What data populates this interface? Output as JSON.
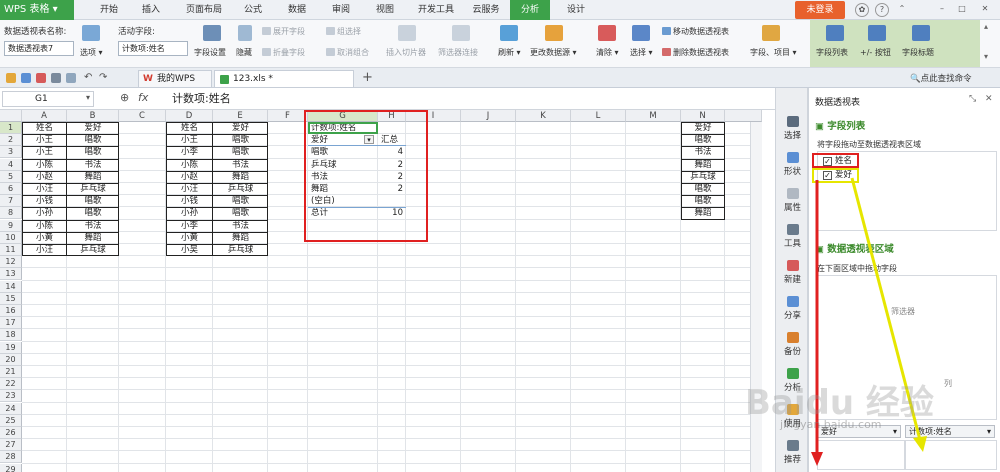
{
  "app": {
    "logo": "WPS 表格",
    "login_label": "未登录"
  },
  "menu": {
    "tabs": [
      "开始",
      "插入",
      "页面布局",
      "公式",
      "数据",
      "审阅",
      "视图",
      "开发工具",
      "云服务",
      "分析",
      "设计"
    ],
    "active": "分析"
  },
  "ribbon": {
    "pivot_name_label": "数据透视表名称:",
    "pivot_name_value": "数据透视表7",
    "options_label": "选项",
    "active_field_label": "活动字段:",
    "active_field_value": "计数项:姓名",
    "field_settings_label": "字段设置",
    "hide_label": "隐藏",
    "expand_label": "展开字段",
    "collapse_label": "折叠字段",
    "group_label": "组选择",
    "ungroup_label": "取消组合",
    "insert_slicer_label": "插入切片器",
    "filter_conn_label": "筛选器连接",
    "refresh_label": "刷新",
    "change_source_label": "更改数据源",
    "clear_label": "清除",
    "select_label": "选择",
    "move_pivot_label": "移动数据透视表",
    "delete_pivot_label": "删除数据透视表",
    "fields_items_label": "字段、项目",
    "field_list_label": "字段列表",
    "plusminus_label": "+/- 按钮",
    "field_headers_label": "字段标题"
  },
  "tabbar": {
    "wps_tab": "我的WPS",
    "file_tab": "123.xls *",
    "search_label": "点此查找命令"
  },
  "formula_bar": {
    "cell_ref": "G1",
    "fx": "fx",
    "content": "计数项:姓名"
  },
  "sheet": {
    "columns": [
      "A",
      "B",
      "C",
      "D",
      "E",
      "F",
      "G",
      "H",
      "I",
      "J",
      "K",
      "L",
      "M",
      "N"
    ],
    "rows": [
      "1",
      "2",
      "3",
      "4",
      "5",
      "6",
      "7",
      "8",
      "9",
      "10",
      "11",
      "12",
      "13",
      "14",
      "15",
      "16",
      "17",
      "18",
      "19",
      "20",
      "21",
      "22",
      "23",
      "24",
      "25",
      "26",
      "27",
      "28",
      "29"
    ],
    "table1": [
      [
        "姓名",
        "爱好"
      ],
      [
        "小王",
        "唱歌"
      ],
      [
        "小王",
        "唱歌"
      ],
      [
        "小陈",
        "书法"
      ],
      [
        "小赵",
        "舞蹈"
      ],
      [
        "小汪",
        "乒乓球"
      ],
      [
        "小钱",
        "唱歌"
      ],
      [
        "小孙",
        "唱歌"
      ],
      [
        "小陈",
        "书法"
      ],
      [
        "小黄",
        "舞蹈"
      ],
      [
        "小汪",
        "乒乓球"
      ]
    ],
    "table2": [
      [
        "姓名",
        "爱好"
      ],
      [
        "小王",
        "唱歌"
      ],
      [
        "小李",
        "唱歌"
      ],
      [
        "小陈",
        "书法"
      ],
      [
        "小赵",
        "舞蹈"
      ],
      [
        "小汪",
        "乒乓球"
      ],
      [
        "小钱",
        "唱歌"
      ],
      [
        "小孙",
        "唱歌"
      ],
      [
        "小李",
        "书法"
      ],
      [
        "小黄",
        "舞蹈"
      ],
      [
        "小吴",
        "乒乓球"
      ]
    ],
    "pivot": {
      "header": "计数项:姓名",
      "row_label": "爱好",
      "value_label": "汇总",
      "rows": [
        [
          "唱歌",
          "4"
        ],
        [
          "乒乓球",
          "2"
        ],
        [
          "书法",
          "2"
        ],
        [
          "舞蹈",
          "2"
        ],
        [
          "(空白)",
          ""
        ],
        [
          "总计",
          "10"
        ]
      ]
    },
    "list_n": [
      "爱好",
      "唱歌",
      "书法",
      "舞蹈",
      "乒乓球",
      "唱歌",
      "唱歌",
      "舞蹈"
    ]
  },
  "side_toolbar": [
    "选择",
    "形状",
    "属性",
    "工具",
    "新建",
    "分享",
    "备份",
    "分析",
    "使用",
    "推荐"
  ],
  "panel": {
    "title": "数据透视表",
    "fields_section": "字段列表",
    "fields_hint": "将字段拖动至数据透视表区域",
    "fields": [
      {
        "name": "姓名",
        "checked": "✓"
      },
      {
        "name": "爱好",
        "checked": "✓"
      }
    ],
    "areas_section": "数据透视表区域",
    "areas_hint": "在下面区域中拖动字段",
    "filter_label": "筛选器",
    "column_label": "列",
    "row_item": "爱好",
    "value_item": "计数项:姓名"
  },
  "watermark": "Baidu 经验",
  "watermark_url": "jingyan.baidu.com",
  "colors": {
    "green": "#3da24a",
    "red": "#e02020",
    "yellow": "#e6e600",
    "accent_green_text": "#3b8a2b"
  }
}
